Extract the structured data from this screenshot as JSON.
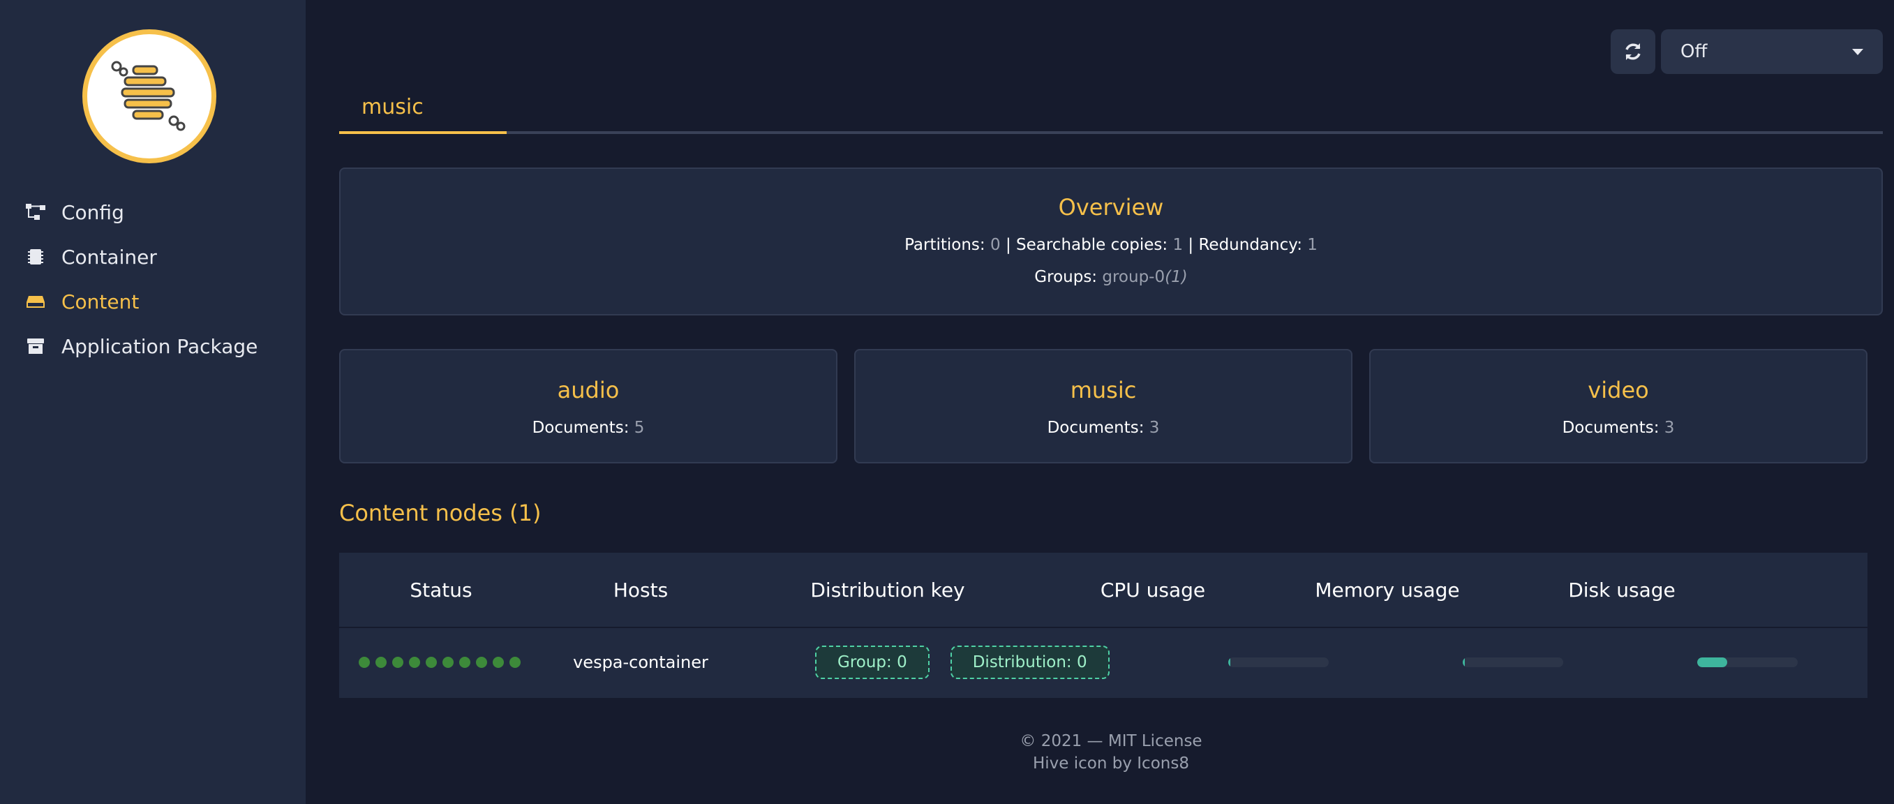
{
  "sidebar": {
    "items": [
      {
        "label": "Config",
        "icon": "sitemap-icon"
      },
      {
        "label": "Container",
        "icon": "chip-icon"
      },
      {
        "label": "Content",
        "icon": "hdd-icon",
        "active": true
      },
      {
        "label": "Application Package",
        "icon": "archive-icon"
      }
    ]
  },
  "toolbar": {
    "refresh_icon": "sync-icon",
    "select_value": "Off"
  },
  "tabs": [
    {
      "label": "music",
      "active": true
    }
  ],
  "overview": {
    "title": "Overview",
    "partitions_label": "Partitions:",
    "partitions_value": "0",
    "searchable_label": "Searchable copies:",
    "searchable_value": "1",
    "redundancy_label": "Redundancy:",
    "redundancy_value": "1",
    "groups_label": "Groups:",
    "groups_value": "group-0",
    "groups_count": "(1)",
    "separator": "|"
  },
  "document_types": [
    {
      "name": "audio",
      "documents_label": "Documents:",
      "documents": "5"
    },
    {
      "name": "music",
      "documents_label": "Documents:",
      "documents": "3"
    },
    {
      "name": "video",
      "documents_label": "Documents:",
      "documents": "3"
    }
  ],
  "content_nodes": {
    "title": "Content nodes (1)",
    "columns": [
      "Status",
      "Hosts",
      "Distribution key",
      "CPU usage",
      "Memory usage",
      "Disk usage"
    ],
    "rows": [
      {
        "status_dots": 10,
        "host": "vespa-container",
        "group_tag": "Group: 0",
        "distribution_tag": "Distribution: 0",
        "cpu_usage": 0.02,
        "memory_usage": 0.02,
        "disk_usage": 0.3
      }
    ]
  },
  "footer": {
    "line1": "© 2021 — MIT License",
    "line2": "Hive icon by Icons8"
  },
  "colors": {
    "accent": "#f6c04a",
    "background": "#161b2d",
    "sidebar": "#212a40",
    "status_ok": "#3d8a3a",
    "usage_fill": "#3eb59d"
  }
}
